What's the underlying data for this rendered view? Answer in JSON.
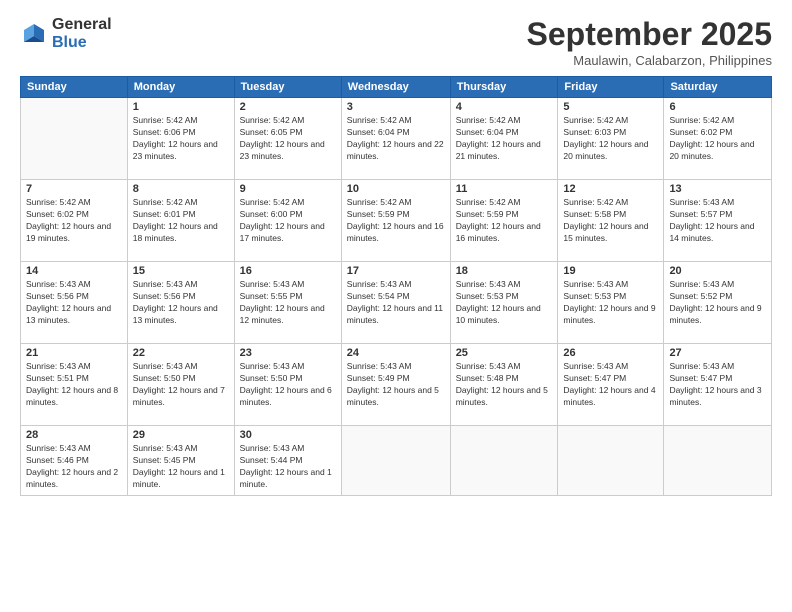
{
  "logo": {
    "general": "General",
    "blue": "Blue"
  },
  "header": {
    "month": "September 2025",
    "location": "Maulawin, Calabarzon, Philippines"
  },
  "weekdays": [
    "Sunday",
    "Monday",
    "Tuesday",
    "Wednesday",
    "Thursday",
    "Friday",
    "Saturday"
  ],
  "weeks": [
    [
      {
        "day": "",
        "sunrise": "",
        "sunset": "",
        "daylight": ""
      },
      {
        "day": "1",
        "sunrise": "Sunrise: 5:42 AM",
        "sunset": "Sunset: 6:06 PM",
        "daylight": "Daylight: 12 hours and 23 minutes."
      },
      {
        "day": "2",
        "sunrise": "Sunrise: 5:42 AM",
        "sunset": "Sunset: 6:05 PM",
        "daylight": "Daylight: 12 hours and 23 minutes."
      },
      {
        "day": "3",
        "sunrise": "Sunrise: 5:42 AM",
        "sunset": "Sunset: 6:04 PM",
        "daylight": "Daylight: 12 hours and 22 minutes."
      },
      {
        "day": "4",
        "sunrise": "Sunrise: 5:42 AM",
        "sunset": "Sunset: 6:04 PM",
        "daylight": "Daylight: 12 hours and 21 minutes."
      },
      {
        "day": "5",
        "sunrise": "Sunrise: 5:42 AM",
        "sunset": "Sunset: 6:03 PM",
        "daylight": "Daylight: 12 hours and 20 minutes."
      },
      {
        "day": "6",
        "sunrise": "Sunrise: 5:42 AM",
        "sunset": "Sunset: 6:02 PM",
        "daylight": "Daylight: 12 hours and 20 minutes."
      }
    ],
    [
      {
        "day": "7",
        "sunrise": "Sunrise: 5:42 AM",
        "sunset": "Sunset: 6:02 PM",
        "daylight": "Daylight: 12 hours and 19 minutes."
      },
      {
        "day": "8",
        "sunrise": "Sunrise: 5:42 AM",
        "sunset": "Sunset: 6:01 PM",
        "daylight": "Daylight: 12 hours and 18 minutes."
      },
      {
        "day": "9",
        "sunrise": "Sunrise: 5:42 AM",
        "sunset": "Sunset: 6:00 PM",
        "daylight": "Daylight: 12 hours and 17 minutes."
      },
      {
        "day": "10",
        "sunrise": "Sunrise: 5:42 AM",
        "sunset": "Sunset: 5:59 PM",
        "daylight": "Daylight: 12 hours and 16 minutes."
      },
      {
        "day": "11",
        "sunrise": "Sunrise: 5:42 AM",
        "sunset": "Sunset: 5:59 PM",
        "daylight": "Daylight: 12 hours and 16 minutes."
      },
      {
        "day": "12",
        "sunrise": "Sunrise: 5:42 AM",
        "sunset": "Sunset: 5:58 PM",
        "daylight": "Daylight: 12 hours and 15 minutes."
      },
      {
        "day": "13",
        "sunrise": "Sunrise: 5:43 AM",
        "sunset": "Sunset: 5:57 PM",
        "daylight": "Daylight: 12 hours and 14 minutes."
      }
    ],
    [
      {
        "day": "14",
        "sunrise": "Sunrise: 5:43 AM",
        "sunset": "Sunset: 5:56 PM",
        "daylight": "Daylight: 12 hours and 13 minutes."
      },
      {
        "day": "15",
        "sunrise": "Sunrise: 5:43 AM",
        "sunset": "Sunset: 5:56 PM",
        "daylight": "Daylight: 12 hours and 13 minutes."
      },
      {
        "day": "16",
        "sunrise": "Sunrise: 5:43 AM",
        "sunset": "Sunset: 5:55 PM",
        "daylight": "Daylight: 12 hours and 12 minutes."
      },
      {
        "day": "17",
        "sunrise": "Sunrise: 5:43 AM",
        "sunset": "Sunset: 5:54 PM",
        "daylight": "Daylight: 12 hours and 11 minutes."
      },
      {
        "day": "18",
        "sunrise": "Sunrise: 5:43 AM",
        "sunset": "Sunset: 5:53 PM",
        "daylight": "Daylight: 12 hours and 10 minutes."
      },
      {
        "day": "19",
        "sunrise": "Sunrise: 5:43 AM",
        "sunset": "Sunset: 5:53 PM",
        "daylight": "Daylight: 12 hours and 9 minutes."
      },
      {
        "day": "20",
        "sunrise": "Sunrise: 5:43 AM",
        "sunset": "Sunset: 5:52 PM",
        "daylight": "Daylight: 12 hours and 9 minutes."
      }
    ],
    [
      {
        "day": "21",
        "sunrise": "Sunrise: 5:43 AM",
        "sunset": "Sunset: 5:51 PM",
        "daylight": "Daylight: 12 hours and 8 minutes."
      },
      {
        "day": "22",
        "sunrise": "Sunrise: 5:43 AM",
        "sunset": "Sunset: 5:50 PM",
        "daylight": "Daylight: 12 hours and 7 minutes."
      },
      {
        "day": "23",
        "sunrise": "Sunrise: 5:43 AM",
        "sunset": "Sunset: 5:50 PM",
        "daylight": "Daylight: 12 hours and 6 minutes."
      },
      {
        "day": "24",
        "sunrise": "Sunrise: 5:43 AM",
        "sunset": "Sunset: 5:49 PM",
        "daylight": "Daylight: 12 hours and 5 minutes."
      },
      {
        "day": "25",
        "sunrise": "Sunrise: 5:43 AM",
        "sunset": "Sunset: 5:48 PM",
        "daylight": "Daylight: 12 hours and 5 minutes."
      },
      {
        "day": "26",
        "sunrise": "Sunrise: 5:43 AM",
        "sunset": "Sunset: 5:47 PM",
        "daylight": "Daylight: 12 hours and 4 minutes."
      },
      {
        "day": "27",
        "sunrise": "Sunrise: 5:43 AM",
        "sunset": "Sunset: 5:47 PM",
        "daylight": "Daylight: 12 hours and 3 minutes."
      }
    ],
    [
      {
        "day": "28",
        "sunrise": "Sunrise: 5:43 AM",
        "sunset": "Sunset: 5:46 PM",
        "daylight": "Daylight: 12 hours and 2 minutes."
      },
      {
        "day": "29",
        "sunrise": "Sunrise: 5:43 AM",
        "sunset": "Sunset: 5:45 PM",
        "daylight": "Daylight: 12 hours and 1 minute."
      },
      {
        "day": "30",
        "sunrise": "Sunrise: 5:43 AM",
        "sunset": "Sunset: 5:44 PM",
        "daylight": "Daylight: 12 hours and 1 minute."
      },
      {
        "day": "",
        "sunrise": "",
        "sunset": "",
        "daylight": ""
      },
      {
        "day": "",
        "sunrise": "",
        "sunset": "",
        "daylight": ""
      },
      {
        "day": "",
        "sunrise": "",
        "sunset": "",
        "daylight": ""
      },
      {
        "day": "",
        "sunrise": "",
        "sunset": "",
        "daylight": ""
      }
    ]
  ]
}
